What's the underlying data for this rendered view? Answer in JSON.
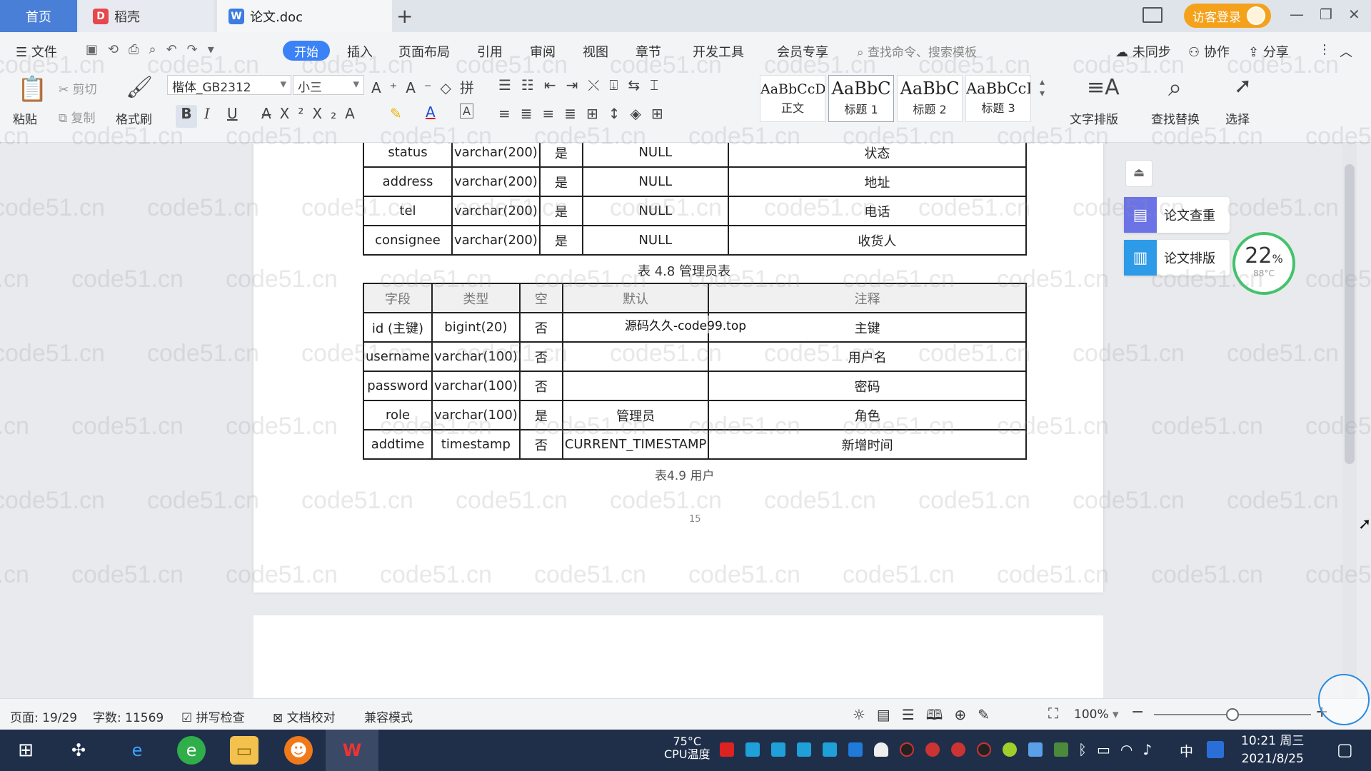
{
  "titlebar": {
    "tabs": [
      "首页",
      "稻壳",
      "论文.doc"
    ],
    "new_tab": "+",
    "login": "访客登录"
  },
  "menubar": {
    "file": "文件",
    "items": [
      "开始",
      "插入",
      "页面布局",
      "引用",
      "审阅",
      "视图",
      "章节",
      "开发工具",
      "会员专享"
    ],
    "search": "查找命令、搜索模板",
    "sync": "未同步",
    "collab": "协作",
    "share": "分享"
  },
  "ribbon": {
    "paste": "粘贴",
    "cut": "剪切",
    "copy": "复制",
    "format_painter": "格式刷",
    "font_name": "楷体_GB2312",
    "font_size": "小三",
    "styles": [
      {
        "preview": "AaBbCcDd",
        "label": "正文"
      },
      {
        "preview": "AaBbC",
        "label": "标题 1"
      },
      {
        "preview": "AaBbC",
        "label": "标题 2"
      },
      {
        "preview": "AaBbCcI",
        "label": "标题 3"
      }
    ],
    "text_layout": "文字排版",
    "find_replace": "查找替换",
    "select": "选择"
  },
  "document": {
    "table1": {
      "rows": [
        [
          "status",
          "varchar(200)",
          "是",
          "NULL",
          "状态"
        ],
        [
          "address",
          "varchar(200)",
          "是",
          "NULL",
          "地址"
        ],
        [
          "tel",
          "varchar(200)",
          "是",
          "NULL",
          "电话"
        ],
        [
          "consignee",
          "varchar(200)",
          "是",
          "NULL",
          "收货人"
        ]
      ]
    },
    "caption1": "表 4.8 管理员表",
    "table2": {
      "headers": [
        "字段",
        "类型",
        "空",
        "默认",
        "注释"
      ],
      "rows": [
        [
          "id (主键)",
          "bigint(20)",
          "否",
          "",
          "主键"
        ],
        [
          "username",
          "varchar(100)",
          "否",
          "",
          "用户名"
        ],
        [
          "password",
          "varchar(100)",
          "否",
          "",
          "密码"
        ],
        [
          "role",
          "varchar(100)",
          "是",
          "管理员",
          "角色"
        ],
        [
          "addtime",
          "timestamp",
          "否",
          "CURRENT_TIMESTAMP",
          "新增时间"
        ]
      ]
    },
    "overlay_text": "源码久久-code99.top",
    "caption2": "表4.9 用户",
    "page_number": "15",
    "watermark": "code51.cn"
  },
  "side_panel": {
    "check": "论文查重",
    "layout": "论文排版",
    "cpu_percent": "22",
    "cpu_unit": "%",
    "cpu_temp": "88°C"
  },
  "statusbar": {
    "page": "页面: 19/29",
    "words": "字数: 11569",
    "spell": "拼写检查",
    "proof": "文档校对",
    "compat": "兼容模式",
    "zoom": "100%",
    "zoom_level": 0.5
  },
  "taskbar": {
    "cpu_temp": "75°C",
    "cpu_label": "CPU温度",
    "ime": "中",
    "time": "10:21 周三",
    "date": "2021/8/25"
  }
}
